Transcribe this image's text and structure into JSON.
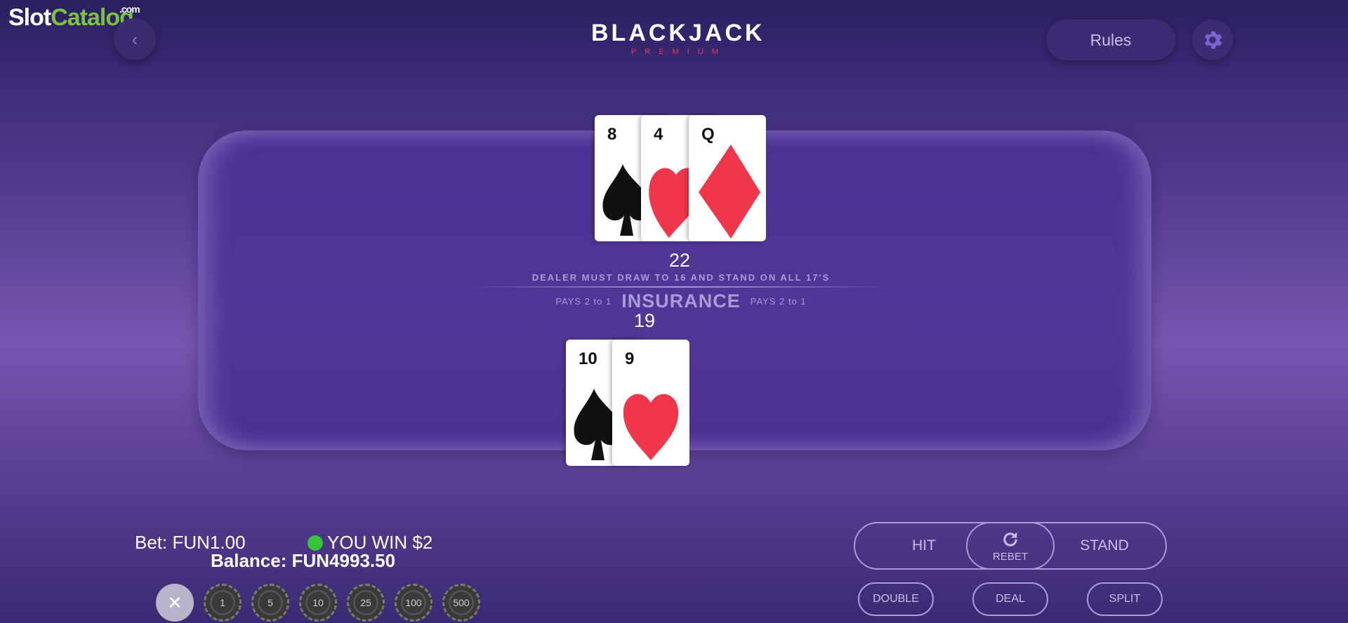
{
  "watermark": {
    "part1": "Slot",
    "part2": "Catalog",
    "part3": ".com"
  },
  "header": {
    "logo_title": "BLACKJACK",
    "logo_subtitle": "PREMIUM",
    "rules_label": "Rules",
    "back_icon": "chevron-left-icon",
    "settings_icon": "gear-icon"
  },
  "dealer": {
    "score": "22",
    "cards": [
      {
        "rank": "8",
        "suit": "spades",
        "color": "#111111"
      },
      {
        "rank": "4",
        "suit": "hearts",
        "color": "#f0364a"
      },
      {
        "rank": "Q",
        "suit": "diamonds",
        "color": "#f0364a"
      }
    ]
  },
  "table": {
    "rule_text": "DEALER MUST DRAW TO 16 AND STAND ON ALL 17'S",
    "insurance_label": "INSURANCE",
    "pays_left": "PAYS 2  to 1",
    "pays_right": "PAYS 2  to 1"
  },
  "player": {
    "score": "19",
    "cards": [
      {
        "rank": "10",
        "suit": "spades",
        "color": "#111111"
      },
      {
        "rank": "9",
        "suit": "hearts",
        "color": "#f0364a"
      }
    ]
  },
  "status": {
    "bet_label": "Bet:",
    "bet_value": "FUN1.00",
    "win_text": "YOU WIN $2",
    "balance_label": "Balance:",
    "balance_value": "FUN4993.50"
  },
  "chips": {
    "clear_icon": "close-icon",
    "values": [
      "1",
      "5",
      "10",
      "25",
      "100",
      "500"
    ]
  },
  "actions": {
    "hit": "HIT",
    "rebet": "REBET",
    "rebet_icon": "refresh-icon",
    "stand": "STAND",
    "double": "DOUBLE",
    "deal": "DEAL",
    "split": "SPLIT"
  },
  "colors": {
    "background": "#5a3f96",
    "felt": "#4b3392",
    "accent": "#a99bd8",
    "red_suit": "#f0364a",
    "win_dot": "#36c23a"
  }
}
